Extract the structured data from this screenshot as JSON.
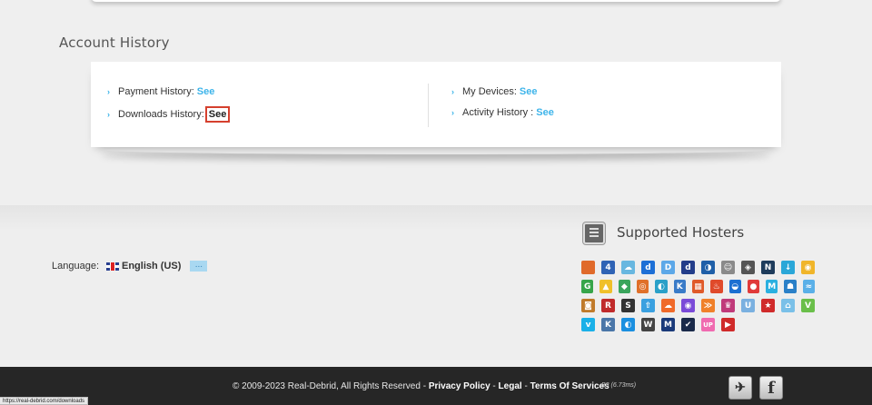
{
  "account_history": {
    "title": "Account History",
    "items": [
      {
        "label": "Payment History:",
        "link": "See"
      },
      {
        "label": "Downloads History:",
        "link": "See"
      },
      {
        "label": "My Devices:",
        "link": "See"
      },
      {
        "label": "Activity History :",
        "link": "See"
      }
    ]
  },
  "language": {
    "label": "Language:",
    "value": "English (US)",
    "more_label": "..."
  },
  "hosters": {
    "title": "Supported Hosters",
    "icon": "document-list-icon",
    "rows": [
      [
        {
          "name": "hoster-1",
          "glyph": "",
          "color": "#e06a2b"
        },
        {
          "name": "hoster-2",
          "glyph": "4",
          "color": "#2f63b5"
        },
        {
          "name": "hoster-3",
          "glyph": "☁",
          "color": "#68b7e0"
        },
        {
          "name": "hoster-4",
          "glyph": "d",
          "color": "#1d6fd6"
        },
        {
          "name": "hoster-5",
          "glyph": "D",
          "color": "#5da8e8"
        },
        {
          "name": "hoster-6",
          "glyph": "d",
          "color": "#233d8a"
        },
        {
          "name": "hoster-7",
          "glyph": "◑",
          "color": "#1f5fa8"
        },
        {
          "name": "hoster-8",
          "glyph": "☺",
          "color": "#8a8a8a"
        },
        {
          "name": "hoster-9",
          "glyph": "◈",
          "color": "#555555"
        },
        {
          "name": "hoster-10",
          "glyph": "N",
          "color": "#1e3c5c"
        },
        {
          "name": "hoster-11",
          "glyph": "↓",
          "color": "#2aa7d8"
        },
        {
          "name": "hoster-12",
          "glyph": "◉",
          "color": "#f0b52a"
        }
      ],
      [
        {
          "name": "hoster-13",
          "glyph": "G",
          "color": "#37a54a"
        },
        {
          "name": "hoster-14",
          "glyph": "▲",
          "color": "#f0c02a"
        },
        {
          "name": "hoster-15",
          "glyph": "◆",
          "color": "#3aa55c"
        },
        {
          "name": "hoster-16",
          "glyph": "◎",
          "color": "#e0702a"
        },
        {
          "name": "hoster-17",
          "glyph": "◐",
          "color": "#2aa0c8"
        },
        {
          "name": "hoster-18",
          "glyph": "K",
          "color": "#3a7bc8"
        },
        {
          "name": "hoster-19",
          "glyph": "▦",
          "color": "#e05a2a"
        },
        {
          "name": "hoster-20",
          "glyph": "♨",
          "color": "#e04a2a"
        },
        {
          "name": "hoster-21",
          "glyph": "◒",
          "color": "#1c6fd1"
        },
        {
          "name": "hoster-22",
          "glyph": "●",
          "color": "#e03a3a"
        },
        {
          "name": "hoster-23",
          "glyph": "M",
          "color": "#2ab0e0"
        },
        {
          "name": "hoster-24",
          "glyph": "☗",
          "color": "#2a80c8"
        },
        {
          "name": "hoster-25",
          "glyph": "≈",
          "color": "#5ab0e8"
        }
      ],
      [
        {
          "name": "hoster-26",
          "glyph": "◙",
          "color": "#c07a2a"
        },
        {
          "name": "hoster-27",
          "glyph": "R",
          "color": "#c02a2a"
        },
        {
          "name": "hoster-28",
          "glyph": "S",
          "color": "#333333"
        },
        {
          "name": "hoster-29",
          "glyph": "⇧",
          "color": "#3aa0e0"
        },
        {
          "name": "hoster-30",
          "glyph": "☁",
          "color": "#f06a2a"
        },
        {
          "name": "hoster-31",
          "glyph": "◉",
          "color": "#7a4ad8"
        },
        {
          "name": "hoster-32",
          "glyph": "≫",
          "color": "#f0802a"
        },
        {
          "name": "hoster-33",
          "glyph": "♛",
          "color": "#c03a7a"
        },
        {
          "name": "hoster-34",
          "glyph": "U",
          "color": "#7ab0e0"
        },
        {
          "name": "hoster-35",
          "glyph": "★",
          "color": "#d02a2a"
        },
        {
          "name": "hoster-36",
          "glyph": "⌂",
          "color": "#7ac0e8"
        },
        {
          "name": "hoster-37",
          "glyph": "V",
          "color": "#6abf4a"
        }
      ],
      [
        {
          "name": "hoster-38",
          "glyph": "v",
          "color": "#1ab0e8"
        },
        {
          "name": "hoster-39",
          "glyph": "K",
          "color": "#4a76a8"
        },
        {
          "name": "hoster-40",
          "glyph": "◐",
          "color": "#1a8fe0"
        },
        {
          "name": "hoster-41",
          "glyph": "W",
          "color": "#444444"
        },
        {
          "name": "hoster-42",
          "glyph": "M",
          "color": "#1a3a7a"
        },
        {
          "name": "hoster-43",
          "glyph": "✔",
          "color": "#1a2a4a"
        },
        {
          "name": "hoster-44",
          "glyph": "UP",
          "color": "#f06ab0"
        },
        {
          "name": "hoster-45",
          "glyph": "▶",
          "color": "#d02a2a"
        }
      ]
    ]
  },
  "footer": {
    "copyright": "© 2009-2023 Real-Debrid, All Rights Reserved -",
    "privacy": "Privacy Policy",
    "sep1": "-",
    "legal": "Legal",
    "sep2": "-",
    "terms": "Terms Of Services",
    "build": "B3 (6.73ms)"
  },
  "social": {
    "twitter_glyph": "✈",
    "facebook_glyph": "f"
  },
  "status_url": "https://real-debrid.com/downloads"
}
